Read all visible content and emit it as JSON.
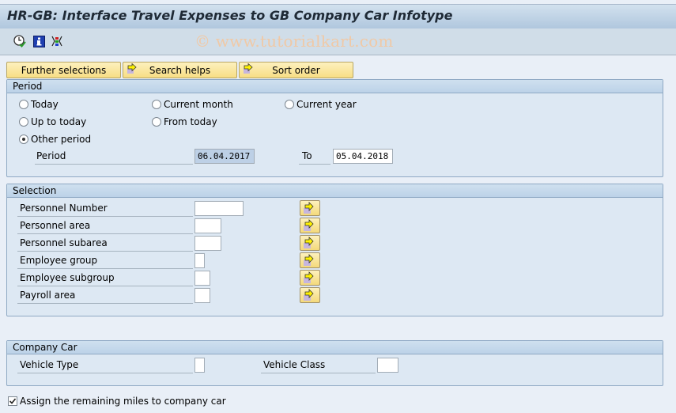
{
  "window": {
    "title": "HR-GB: Interface Travel Expenses to GB Company Car Infotype",
    "watermark": "© www.tutorialkart.com"
  },
  "toolbar": {
    "icons": [
      "execute-icon",
      "info-icon",
      "selection-options-icon"
    ]
  },
  "buttons": {
    "further_selections": "Further selections",
    "search_helps": "Search helps",
    "sort_order": "Sort order"
  },
  "period": {
    "header": "Period",
    "options": [
      {
        "label": "Today",
        "selected": false
      },
      {
        "label": "Current month",
        "selected": false
      },
      {
        "label": "Current year",
        "selected": false
      },
      {
        "label": "Up to today",
        "selected": false
      },
      {
        "label": "From today",
        "selected": false
      },
      {
        "label": "Other period",
        "selected": true
      }
    ],
    "period_label": "Period",
    "from_value": "06.04.2017",
    "to_label": "To",
    "to_value": "05.04.2018"
  },
  "selection": {
    "header": "Selection",
    "fields": [
      {
        "label": "Personnel Number",
        "value": ""
      },
      {
        "label": "Personnel area",
        "value": ""
      },
      {
        "label": "Personnel subarea",
        "value": ""
      },
      {
        "label": "Employee group",
        "value": ""
      },
      {
        "label": "Employee subgroup",
        "value": ""
      },
      {
        "label": "Payroll area",
        "value": ""
      }
    ]
  },
  "company_car": {
    "header": "Company Car",
    "vehicle_type_label": "Vehicle Type",
    "vehicle_type_value": "",
    "vehicle_class_label": "Vehicle Class",
    "vehicle_class_value": ""
  },
  "assign_miles": {
    "label": "Assign the remaining miles to company car",
    "checked": true
  }
}
